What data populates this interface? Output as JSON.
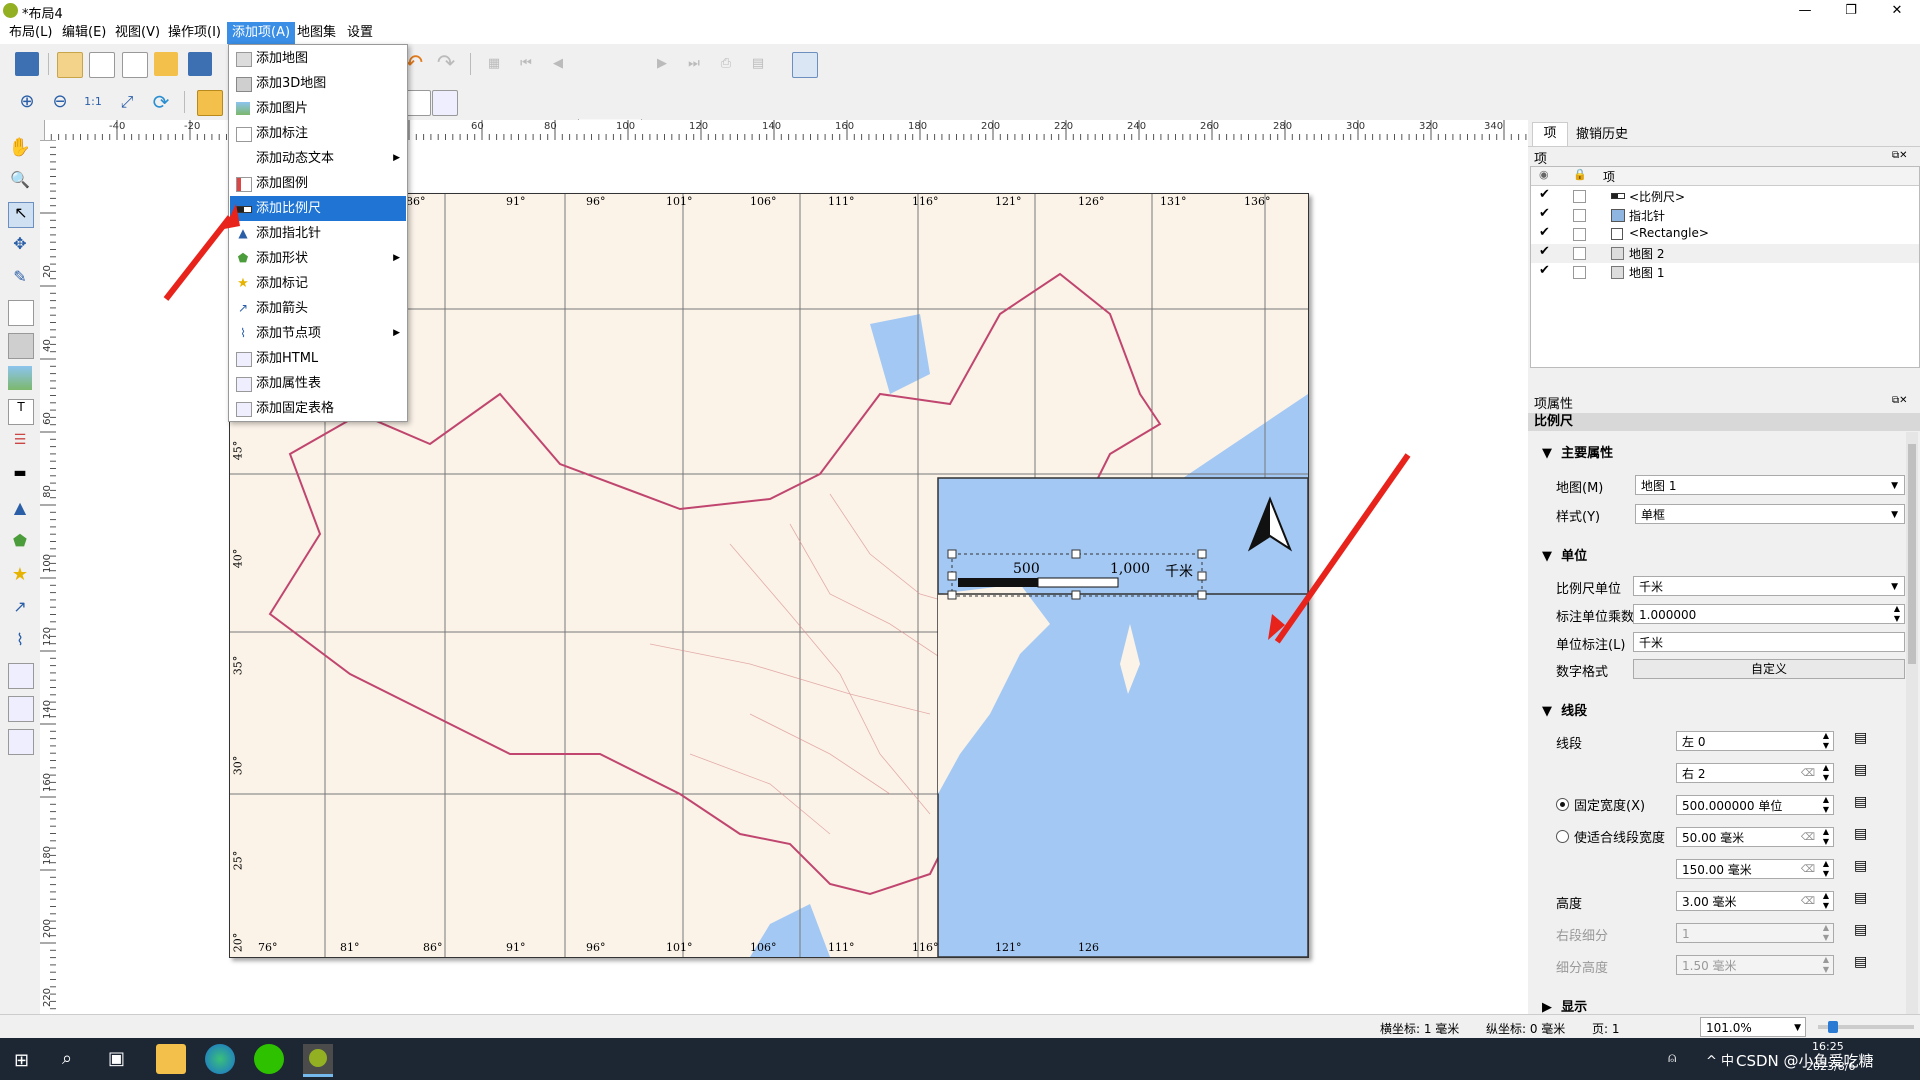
{
  "window": {
    "title": "*布局4",
    "controls": [
      "—",
      "❐",
      "✕"
    ]
  },
  "menubar": {
    "items": [
      {
        "label": "布局(L)",
        "active": false
      },
      {
        "label": "编辑(E)",
        "active": false
      },
      {
        "label": "视图(V)",
        "active": false
      },
      {
        "label": "操作项(I)",
        "active": false
      },
      {
        "label": "添加项(A)",
        "active": true
      },
      {
        "label": "地图集",
        "active": false
      },
      {
        "label": "设置",
        "active": false
      }
    ]
  },
  "toolbar": {
    "page_value": "1"
  },
  "dropdown": {
    "items": [
      {
        "label": "添加地图",
        "icon": "map-icon",
        "submenu": false,
        "selected": false
      },
      {
        "label": "添加3D地图",
        "icon": "map3d-icon",
        "submenu": false,
        "selected": false
      },
      {
        "label": "添加图片",
        "icon": "picture-icon",
        "submenu": false,
        "selected": false
      },
      {
        "label": "添加标注",
        "icon": "label-icon",
        "submenu": false,
        "selected": false
      },
      {
        "label": "添加动态文本",
        "icon": "",
        "submenu": true,
        "selected": false
      },
      {
        "label": "添加图例",
        "icon": "legend-icon",
        "submenu": false,
        "selected": false
      },
      {
        "label": "添加比例尺",
        "icon": "scalebar-icon",
        "submenu": false,
        "selected": true
      },
      {
        "label": "添加指北针",
        "icon": "north-arrow-icon",
        "submenu": false,
        "selected": false
      },
      {
        "label": "添加形状",
        "icon": "shape-icon",
        "submenu": true,
        "selected": false
      },
      {
        "label": "添加标记",
        "icon": "marker-icon",
        "submenu": false,
        "selected": false
      },
      {
        "label": "添加箭头",
        "icon": "arrow-icon",
        "submenu": false,
        "selected": false
      },
      {
        "label": "添加节点项",
        "icon": "node-icon",
        "submenu": true,
        "selected": false
      },
      {
        "label": "添加HTML",
        "icon": "html-icon",
        "submenu": false,
        "selected": false
      },
      {
        "label": "添加属性表",
        "icon": "attribute-table-icon",
        "submenu": false,
        "selected": false
      },
      {
        "label": "添加固定表格",
        "icon": "fixed-table-icon",
        "submenu": false,
        "selected": false
      }
    ]
  },
  "hruler": {
    "labels": [
      "-40",
      "-20",
      "60",
      "80",
      "100",
      "120",
      "140",
      "160",
      "180",
      "200",
      "220",
      "240",
      "260",
      "280",
      "300",
      "320",
      "340"
    ]
  },
  "vruler": {
    "labels": [
      "20",
      "40",
      "60",
      "80",
      "100",
      "120",
      "140",
      "160",
      "180",
      "200",
      "220"
    ]
  },
  "map": {
    "top_lon": [
      "86°",
      "91°",
      "96°",
      "101°",
      "106°",
      "111°",
      "116°",
      "121°",
      "126°",
      "131°",
      "136°"
    ],
    "bottom_lon": [
      "76°",
      "81°",
      "86°",
      "91°",
      "96°",
      "101°",
      "106°",
      "111°",
      "116°",
      "121°",
      "126"
    ],
    "left_lat": [
      "45°",
      "40°",
      "35°",
      "30°",
      "25°",
      "20°"
    ],
    "scalebar": {
      "label_mid": "500",
      "label_end": "1,000",
      "unit": "千米"
    },
    "colors": {
      "land": "#fbf3e8",
      "sea": "#a3c8f3",
      "border": "#c0466f",
      "grid": "#777777"
    }
  },
  "panel": {
    "tabs": [
      "项",
      "撤销历史"
    ],
    "items_title": "项",
    "items_header": "项",
    "items": [
      {
        "label": "<比例尺>",
        "visible": true,
        "icon": "scalebar-icon"
      },
      {
        "label": "指北针",
        "visible": true,
        "icon": "north-arrow-icon"
      },
      {
        "label": "<Rectangle>",
        "visible": true,
        "icon": "rectangle-icon"
      },
      {
        "label": "地图 2",
        "visible": true,
        "icon": "map-icon"
      },
      {
        "label": "地图 1",
        "visible": true,
        "icon": "map-icon"
      }
    ],
    "props_title": "项属性",
    "props_subtitle": "比例尺",
    "main_section": "主要属性",
    "map_label": "地图(M)",
    "map_value": "地图 1",
    "style_label": "样式(Y)",
    "style_value": "单框",
    "units_section": "单位",
    "scale_unit_label": "比例尺单位",
    "scale_unit_value": "千米",
    "label_multiplier_label": "标注单位乘数",
    "label_multiplier_value": "1.000000",
    "unit_label_label": "单位标注(L)",
    "unit_label_value": "千米",
    "number_format_label": "数字格式",
    "number_format_button": "自定义",
    "segments_section": "线段",
    "segments_label": "线段",
    "seg_left": "左 0",
    "seg_right": "右 2",
    "fixed_width_label": "固定宽度(X)",
    "fixed_width_value": "500.000000 单位",
    "fit_width_label": "使适合线段宽度",
    "fit_min": "50.00 毫米",
    "fit_max": "150.00 毫米",
    "height_label": "高度",
    "height_value": "3.00 毫米",
    "right_subdiv_label": "右段细分",
    "right_subdiv_value": "1",
    "subdiv_height_label": "细分高度",
    "subdiv_height_value": "1.50 毫米",
    "display_section": "显示"
  },
  "statusbar": {
    "x_coord": "横坐标: 1 毫米",
    "y_coord": "纵坐标: 0 毫米",
    "page": "页: 1",
    "zoom": "101.0%"
  },
  "taskbar": {
    "time": "16:25",
    "date": "2023/8/6",
    "watermark": "CSDN @小鱼爱吃糖",
    "tray": "^ 中"
  }
}
